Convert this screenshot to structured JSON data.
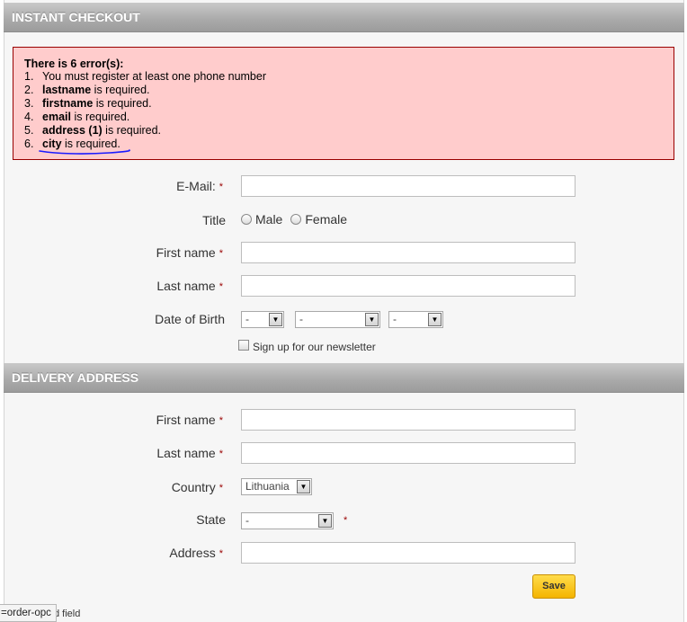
{
  "checkout": {
    "title": "INSTANT CHECKOUT"
  },
  "errors": {
    "title": "There is 6 error(s):",
    "items": [
      {
        "num": "1.",
        "bold": "",
        "text": "You must register at least one phone number"
      },
      {
        "num": "2.",
        "bold": "lastname",
        "text": " is required."
      },
      {
        "num": "3.",
        "bold": "firstname",
        "text": " is required."
      },
      {
        "num": "4.",
        "bold": "email",
        "text": " is required."
      },
      {
        "num": "5.",
        "bold": "address (1)",
        "text": " is required."
      },
      {
        "num": "6.",
        "bold": "city",
        "text": " is required."
      }
    ]
  },
  "account_form": {
    "email_label": "E-Mail:",
    "title_label": "Title",
    "title_options": [
      "Male",
      "Female"
    ],
    "firstname_label": "First name",
    "lastname_label": "Last name",
    "dob_label": "Date of Birth",
    "dob_day": "-",
    "dob_month": "-",
    "dob_year": "-",
    "newsletter_label": "Sign up for our newsletter",
    "required_marker": "*"
  },
  "delivery": {
    "title": "DELIVERY ADDRESS",
    "firstname_label": "First name",
    "lastname_label": "Last name",
    "country_label": "Country",
    "country_value": "Lithuania",
    "state_label": "State",
    "state_value": "-",
    "address_label": "Address",
    "save_label": "Save"
  },
  "status_bar": {
    "tooltip": "=order-opc",
    "footer_text": "d field"
  },
  "colors": {
    "error_bg": "#ffcccc",
    "error_border": "#990000",
    "required": "#990000",
    "save_button": "#f4b400",
    "annotation_pen": "#1a1aff"
  }
}
